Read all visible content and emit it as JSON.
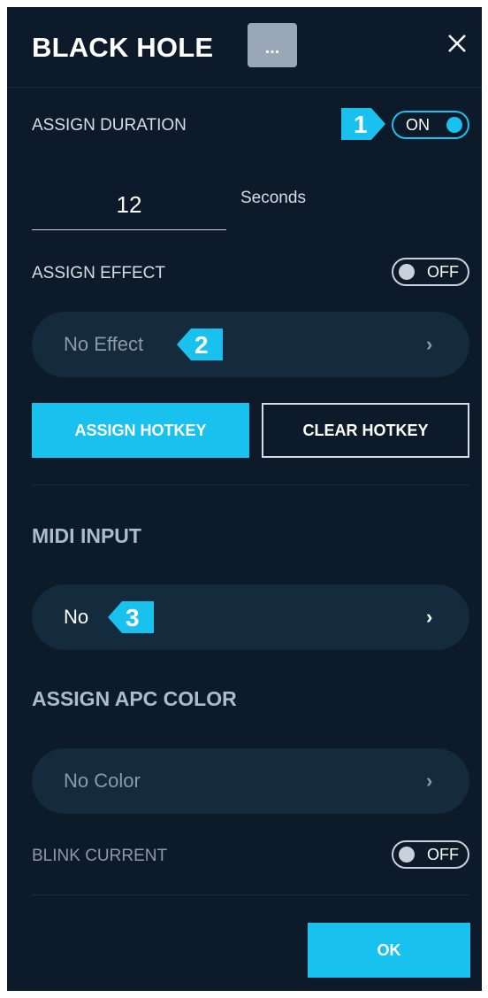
{
  "dialog": {
    "title": "BLACK HOLE",
    "more_label": "...",
    "close_icon": "close-icon"
  },
  "assign_duration": {
    "label": "ASSIGN DURATION",
    "toggle": "ON",
    "value": "12",
    "unit": "Seconds"
  },
  "assign_effect": {
    "label": "ASSIGN EFFECT",
    "toggle": "OFF",
    "selected": "No Effect"
  },
  "hotkey": {
    "assign_label": "ASSIGN HOTKEY",
    "clear_label": "CLEAR HOTKEY"
  },
  "midi_input": {
    "label": "MIDI INPUT",
    "selected": "No"
  },
  "apc_color": {
    "label": "ASSIGN APC COLOR",
    "selected": "No Color"
  },
  "blink_current": {
    "label": "BLINK CURRENT",
    "toggle": "OFF"
  },
  "footer": {
    "ok_label": "OK"
  },
  "step_markers": [
    "1",
    "2",
    "3"
  ],
  "colors": {
    "background": "#0c1a2a",
    "accent": "#19c1ee",
    "pill": "#132b3d"
  }
}
